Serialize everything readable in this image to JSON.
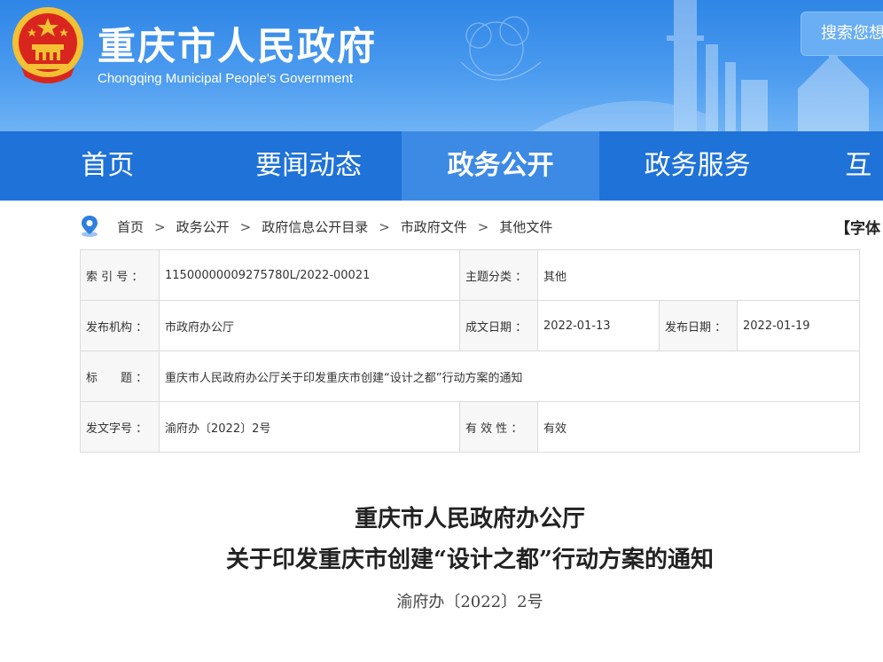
{
  "header": {
    "title": "重庆市人民政府",
    "subtitle": "Chongqing Municipal People's Government",
    "search_label": "搜索您想"
  },
  "nav": {
    "items": [
      {
        "label": "首页",
        "active": false
      },
      {
        "label": "要闻动态",
        "active": false
      },
      {
        "label": "政务公开",
        "active": true
      },
      {
        "label": "政务服务",
        "active": false
      },
      {
        "label": "互",
        "active": false
      }
    ]
  },
  "breadcrumb": {
    "items": [
      "首页",
      "政务公开",
      "政府信息公开目录",
      "市政府文件",
      "其他文件"
    ],
    "separator": ">"
  },
  "font_size_control": "【字体",
  "info": {
    "index_label": "索 引 号 ：",
    "index_value": "11500000009275780L/2022-00021",
    "topic_label": "主题分类 ：",
    "topic_value": "其他",
    "publisher_label": "发布机构 ：",
    "publisher_value": "市政府办公厅",
    "created_label": "成文日期 ：",
    "created_value": "2022-01-13",
    "published_label": "发布日期 ：",
    "published_value": "2022-01-19",
    "title_label": "标　　题 ：",
    "title_value": "重庆市人民政府办公厅关于印发重庆市创建“设计之都”行动方案的通知",
    "docno_label": "发文字号 ：",
    "docno_value": "渝府办〔2022〕2号",
    "validity_label": "有 效 性 ：",
    "validity_value": "有效"
  },
  "document": {
    "title_line1": "重庆市人民政府办公厅",
    "title_line2": "关于印发重庆市创建“设计之都”行动方案的通知",
    "number": "渝府办〔2022〕2号"
  },
  "colors": {
    "header_blue": "#2f86e6",
    "nav_blue": "#1f72d8",
    "nav_active": "#3d8ae5",
    "emblem_red": "#d8261f",
    "emblem_gold": "#f3c133"
  },
  "icons": {
    "emblem": "national-emblem-icon",
    "location": "location-pin-icon"
  }
}
